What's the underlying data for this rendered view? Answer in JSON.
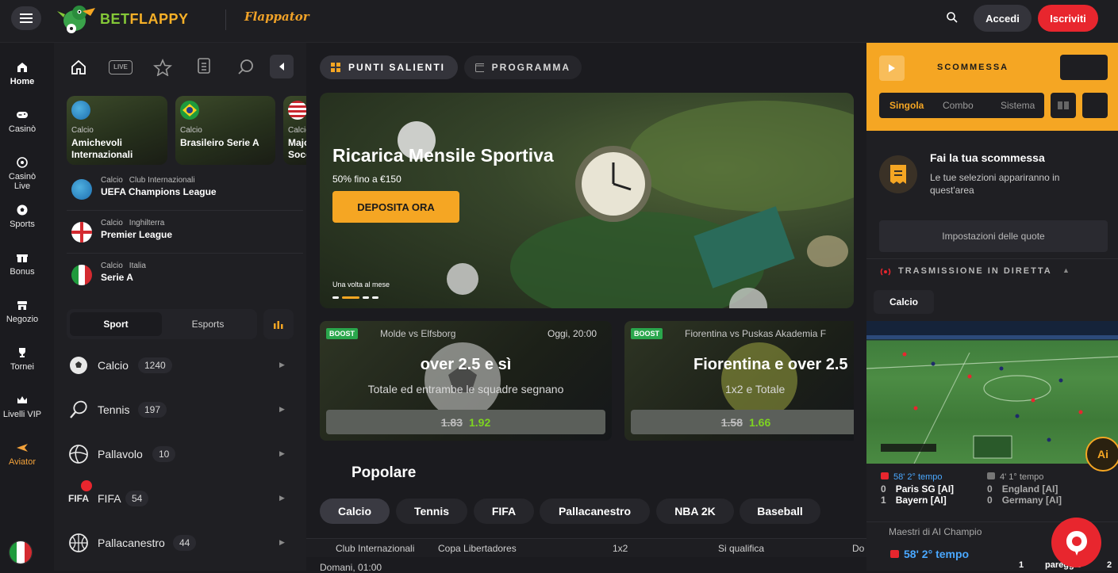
{
  "header": {
    "logo_text_a": "BET",
    "logo_text_b": "FLAPPY",
    "flappator": "Flappator",
    "login": "Accedi",
    "register": "Iscriviti",
    "colors": {
      "accent": "#f5a623",
      "register": "#e8262e",
      "brand_green": "#84c838"
    }
  },
  "nav": [
    {
      "label": "Home",
      "icon": "home-icon"
    },
    {
      "label": "Casinò",
      "icon": "gamepad-icon"
    },
    {
      "label": "Casinò Live",
      "icon": "live-casino-icon"
    },
    {
      "label": "Sports",
      "icon": "soccer-ball-icon"
    },
    {
      "label": "Bonus",
      "icon": "gift-icon"
    },
    {
      "label": "Negozio",
      "icon": "shop-icon"
    },
    {
      "label": "Tornei",
      "icon": "trophy-icon"
    },
    {
      "label": "Livelli VIP",
      "icon": "crown-icon"
    },
    {
      "label": "Aviator",
      "icon": "plane-icon"
    }
  ],
  "sports_toolbar": {
    "live": "LIVE"
  },
  "featured_cards": [
    {
      "sport": "Calcio",
      "name": "Amichevoli Internazionali"
    },
    {
      "sport": "Calcio",
      "name": "Brasileiro Serie A"
    },
    {
      "sport": "Calcio",
      "name": "Majo Socc"
    }
  ],
  "leagues": [
    {
      "sport": "Calcio",
      "region": "Club Internazionali",
      "name": "UEFA Champions League"
    },
    {
      "sport": "Calcio",
      "region": "Inghilterra",
      "name": "Premier League"
    },
    {
      "sport": "Calcio",
      "region": "Italia",
      "name": "Serie A"
    }
  ],
  "sports_tabs": {
    "sport": "Sport",
    "esports": "Esports"
  },
  "sports_list": [
    {
      "name": "Calcio",
      "count": "1240"
    },
    {
      "name": "Tennis",
      "count": "197"
    },
    {
      "name": "Pallavolo",
      "count": "10"
    },
    {
      "name": "FIFA",
      "count": "54"
    },
    {
      "name": "Pallacanestro",
      "count": "44"
    }
  ],
  "main_tabs": {
    "highlights": "PUNTI SALIENTI",
    "schedule": "PROGRAMMA"
  },
  "hero": {
    "title": "Ricarica Mensile Sportiva",
    "subtitle": "50% fino a €150",
    "cta": "DEPOSITA ORA",
    "note": "Una volta al mese"
  },
  "boosts": [
    {
      "badge": "BOOST",
      "match": "Molde vs Elfsborg",
      "time": "Oggi, 20:00",
      "title": "over 2.5 e sì",
      "desc": "Totale ed entrambe le squadre segnano",
      "old_odds": "1.83",
      "new_odds": "1.92"
    },
    {
      "badge": "BOOST",
      "match": "Fiorentina vs Puskas Akademia F",
      "time": "",
      "title": "Fiorentina e over 2.5",
      "desc": "1x2 e Totale",
      "old_odds": "1.58",
      "new_odds": "1.66"
    }
  ],
  "popular": {
    "title": "Popolare",
    "chips": [
      "Calcio",
      "Tennis",
      "FIFA",
      "Pallacanestro",
      "NBA 2K",
      "Baseball"
    ]
  },
  "table_header": {
    "col1": "Club Internazionali",
    "col2": "Copa Libertadores",
    "col3": "1x2",
    "col4": "Si qualifica",
    "col5": "Do",
    "row_time": "Domani, 01:00"
  },
  "betslip": {
    "title": "SCOMMESSA",
    "tabs": [
      "Singola",
      "Combo",
      "Sistema"
    ],
    "empty_title": "Fai la tua scommessa",
    "empty_desc": "Le tue selezioni appariranno in quest'area",
    "odds_settings": "Impostazioni delle quote"
  },
  "live_stream": {
    "title": "TRASMISSIONE IN DIRETTA",
    "sport": "Calcio",
    "ai_label": "Ai",
    "matches": [
      {
        "time": "58' 2° tempo",
        "home_score": "0",
        "home": "Paris SG [AI]",
        "away_score": "1",
        "away": "Bayern [AI]"
      },
      {
        "time": "4' 1° tempo",
        "home_score": "0",
        "home": "England [AI]",
        "away_score": "0",
        "away": "Germany [AI]"
      }
    ],
    "league_row": "Maestri di AI Champio",
    "bottom_time": "58' 2° tempo",
    "bottom_col1": "1",
    "bottom_col2": "pareggio",
    "bottom_col3": "2"
  }
}
